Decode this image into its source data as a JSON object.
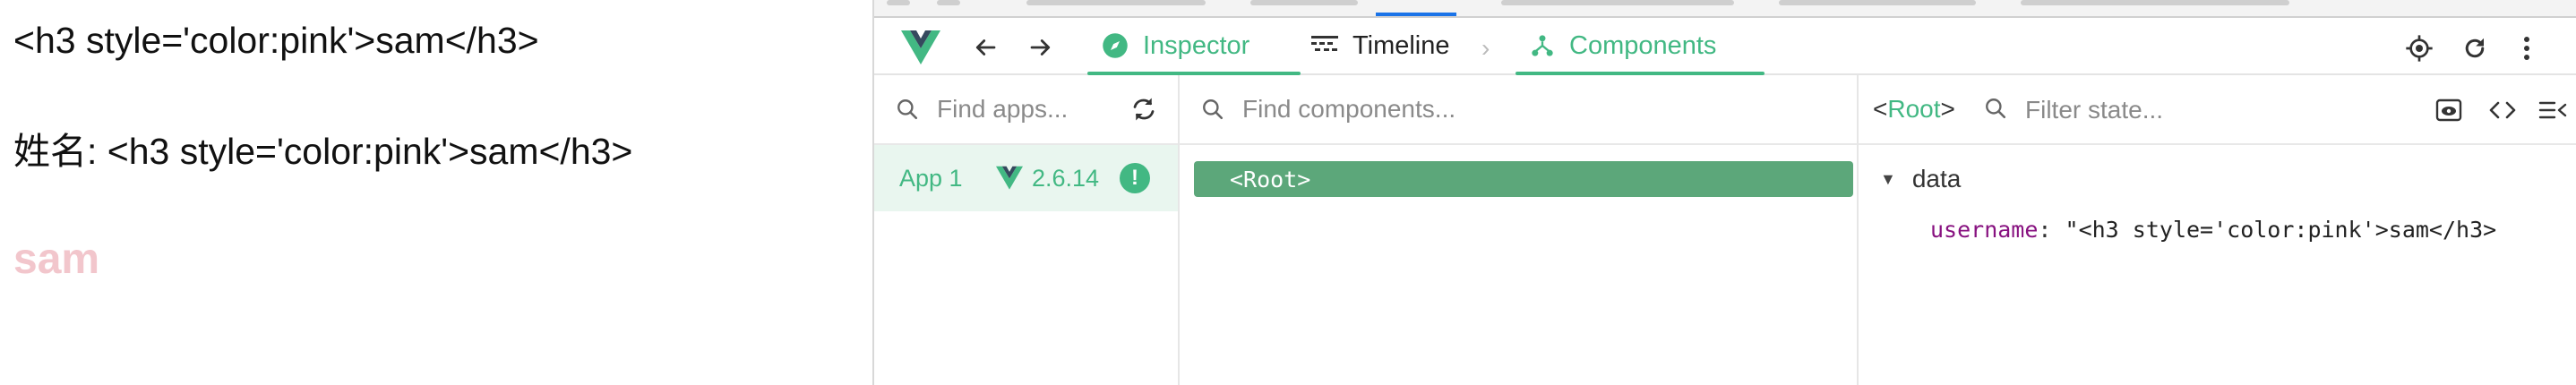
{
  "page": {
    "line1": "<h3 style='color:pink'>sam</h3>",
    "line2": "姓名: <h3 style='color:pink'>sam</h3>",
    "line3": "sam"
  },
  "devtools": {
    "toolbar": {
      "tabs": [
        {
          "label": "Inspector",
          "icon": "inspector-compass-icon",
          "active": true
        },
        {
          "label": "Timeline",
          "icon": "timeline-icon",
          "active": false
        },
        {
          "label": "Components",
          "icon": "components-tree-icon",
          "active": true
        }
      ],
      "right_icons": [
        "select-target-icon",
        "refresh-icon",
        "more-vertical-icon"
      ]
    },
    "apps": {
      "search_placeholder": "Find apps...",
      "items": [
        {
          "name": "App 1",
          "version": "2.6.14",
          "badge": "!"
        }
      ]
    },
    "tree": {
      "search_placeholder": "Find components...",
      "items": [
        {
          "label": "<Root>",
          "selected": true
        }
      ]
    },
    "state": {
      "root_tag": "Root",
      "root_open": "<",
      "root_close": ">",
      "filter_placeholder": "Filter state...",
      "section": "data",
      "props": [
        {
          "key": "username",
          "value": "\"<h3 style='color:pink'>sam</h3>"
        }
      ],
      "header_icons": [
        "eye-icon",
        "code-icon",
        "collapse-list-icon"
      ]
    }
  },
  "colors": {
    "vue_green": "#42b883",
    "selected_row": "#5ca77a",
    "app_row_bg": "#e9f6ef",
    "pink_text": "#f2c6cc",
    "prop_key": "#881280"
  }
}
